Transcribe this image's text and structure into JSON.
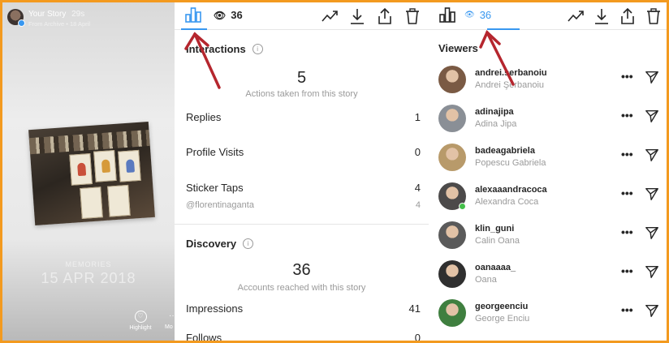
{
  "story": {
    "username": "Your Story",
    "time": "29s",
    "subtitle": "From Archive • 18 April",
    "watermark_top": "MEMORIES",
    "watermark_date": "15 APR 2018",
    "highlight_label": "Highlight",
    "more_label": "Mo"
  },
  "insights": {
    "views_count": "36",
    "interactions": {
      "title": "Interactions",
      "total": "5",
      "caption": "Actions taken from this story",
      "rows": [
        {
          "label": "Replies",
          "value": "1"
        },
        {
          "label": "Profile Visits",
          "value": "0"
        },
        {
          "label": "Sticker Taps",
          "value": "4"
        }
      ],
      "sticker_sub": {
        "label": "@florentinaganta",
        "value": "4"
      }
    },
    "discovery": {
      "title": "Discovery",
      "total": "36",
      "caption": "Accounts reached with this story",
      "rows": [
        {
          "label": "Impressions",
          "value": "41"
        },
        {
          "label": "Follows",
          "value": "0"
        }
      ]
    }
  },
  "viewers": {
    "views_count": "36",
    "title": "Viewers",
    "list": [
      {
        "username": "andrei.serbanoiu",
        "name": "Andrei Şerbanoiu",
        "online": false,
        "avatar": "#7a5a44"
      },
      {
        "username": "adinajipa",
        "name": "Adina Jipa",
        "online": false,
        "avatar": "#8a8f96"
      },
      {
        "username": "badeagabriela",
        "name": "Popescu Gabriela",
        "online": false,
        "avatar": "#b89a6a"
      },
      {
        "username": "alexaaandracoca",
        "name": "Alexandra Coca",
        "online": true,
        "avatar": "#4c4a4a"
      },
      {
        "username": "klin_guni",
        "name": "Calin Oana",
        "online": false,
        "avatar": "#5a5a5a"
      },
      {
        "username": "oanaaaa_",
        "name": "Oana",
        "online": false,
        "avatar": "#2f2f2f"
      },
      {
        "username": "georgeenciu",
        "name": "George Enciu",
        "online": false,
        "avatar": "#3f7f3f"
      }
    ],
    "more_glyph": "•••"
  },
  "colors": {
    "frame": "#f39a1f",
    "accent": "#3897f0",
    "arrow": "#b5262e",
    "online": "#44c04a"
  }
}
